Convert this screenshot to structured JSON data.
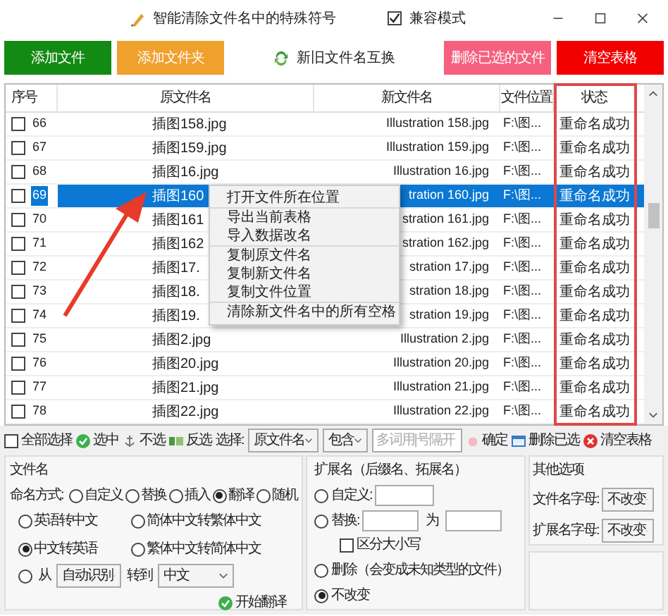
{
  "window": {
    "title": "智能清除文件名中的特殊符号",
    "compat_mode": {
      "label": "兼容模式",
      "checked": true
    }
  },
  "top_buttons": [
    {
      "label": "添加文件",
      "kind": "filled",
      "color": "#138a13"
    },
    {
      "label": "添加文件夹",
      "kind": "filled",
      "color": "#f0a02c"
    },
    {
      "label": "新旧文件名互换",
      "kind": "icon"
    },
    {
      "label": "删除已选的文件",
      "kind": "filled",
      "color": "#f5607e"
    },
    {
      "label": "清空表格",
      "kind": "filled",
      "color": "#f20000"
    }
  ],
  "table": {
    "columns": [
      "序号",
      "原文件名",
      "新文件名",
      "文件位置",
      "状态"
    ],
    "rows": [
      {
        "number": "66",
        "original": "插图158.jpg",
        "new": "Illustration 158.jpg",
        "location": "F:\\图...",
        "status": "重命名成功",
        "checked": false,
        "selected": false
      },
      {
        "number": "67",
        "original": "插图159.jpg",
        "new": "Illustration 159.jpg",
        "location": "F:\\图...",
        "status": "重命名成功",
        "checked": false,
        "selected": false
      },
      {
        "number": "68",
        "original": "插图16.jpg",
        "new": "Illustration 16.jpg",
        "location": "F:\\图...",
        "status": "重命名成功",
        "checked": false,
        "selected": false
      },
      {
        "number": "69",
        "original": "插图160",
        "new": "tration 160.jpg",
        "location": "F:\\图...",
        "status": "重命名成功",
        "checked": false,
        "selected": true
      },
      {
        "number": "70",
        "original": "插图161",
        "new": "stration 161.jpg",
        "location": "F:\\图...",
        "status": "重命名成功",
        "checked": false,
        "selected": false
      },
      {
        "number": "71",
        "original": "插图162",
        "new": "stration 162.jpg",
        "location": "F:\\图...",
        "status": "重命名成功",
        "checked": false,
        "selected": false
      },
      {
        "number": "72",
        "original": "插图17.",
        "new": "stration 17.jpg",
        "location": "F:\\图...",
        "status": "重命名成功",
        "checked": false,
        "selected": false
      },
      {
        "number": "73",
        "original": "插图18.",
        "new": "stration 18.jpg",
        "location": "F:\\图...",
        "status": "重命名成功",
        "checked": false,
        "selected": false
      },
      {
        "number": "74",
        "original": "插图19.",
        "new": "stration 19.jpg",
        "location": "F:\\图...",
        "status": "重命名成功",
        "checked": false,
        "selected": false
      },
      {
        "number": "75",
        "original": "插图2.jpg",
        "new": "Illustration 2.jpg",
        "location": "F:\\图...",
        "status": "重命名成功",
        "checked": false,
        "selected": false
      },
      {
        "number": "76",
        "original": "插图20.jpg",
        "new": "Illustration 20.jpg",
        "location": "F:\\图...",
        "status": "重命名成功",
        "checked": false,
        "selected": false
      },
      {
        "number": "77",
        "original": "插图21.jpg",
        "new": "Illustration 21.jpg",
        "location": "F:\\图...",
        "status": "重命名成功",
        "checked": false,
        "selected": false
      },
      {
        "number": "78",
        "original": "插图22.jpg",
        "new": "Illustration 22.jpg",
        "location": "F:\\图...",
        "status": "重命名成功",
        "checked": false,
        "selected": false
      }
    ]
  },
  "context_menu": {
    "groups": [
      [
        "打开文件所在位置"
      ],
      [
        "导出当前表格",
        "导入数据改名"
      ],
      [
        "复制原文件名",
        "复制新文件名",
        "复制文件位置"
      ],
      [
        "清除新文件名中的所有空格"
      ]
    ]
  },
  "selection_bar": {
    "select_all": {
      "label": "全部选择",
      "checked": false
    },
    "actions": [
      {
        "label": "选中",
        "kind": "check"
      },
      {
        "label": "不选",
        "kind": "anchor"
      },
      {
        "label": "反选",
        "kind": "invert"
      }
    ],
    "select_label": "选择:",
    "field_select": "原文件名",
    "match_select": "包含",
    "keyword_placeholder": "多词用|号隔开",
    "confirm": "确定",
    "delete_selected": "删除已选",
    "clear_table": "清空表格"
  },
  "filename_panel": {
    "title": "文件名",
    "mode_label": "命名方式:",
    "modes": [
      {
        "label": "自定义",
        "selected": false
      },
      {
        "label": "替换",
        "selected": false
      },
      {
        "label": "插入",
        "selected": false
      },
      {
        "label": "翻译",
        "selected": true
      },
      {
        "label": "随机",
        "selected": false
      }
    ],
    "translate_options": [
      {
        "label": "英语转中文",
        "selected": false
      },
      {
        "label": "简体中文转繁体中文",
        "selected": false
      },
      {
        "label": "中文转英语",
        "selected": true
      },
      {
        "label": "繁体中文转简体中文",
        "selected": false
      }
    ],
    "from_option": {
      "label": "从",
      "selected": false
    },
    "from_lang": "自动识别",
    "to_label": "转到",
    "to_lang": "中文",
    "start": "开始翻译"
  },
  "extension_panel": {
    "title": "扩展名（后缀名、拓展名）",
    "options": [
      {
        "kind": "custom",
        "label": "自定义:",
        "selected": false
      },
      {
        "kind": "replace",
        "label": "替换:",
        "with_label": "为",
        "selected": false
      },
      {
        "kind": "delete",
        "label": "删除（会变成未知类型的文件）",
        "selected": false
      },
      {
        "kind": "keep",
        "label": "不改变",
        "selected": true
      }
    ],
    "case_sensitive": {
      "label": "区分大小写",
      "checked": false
    }
  },
  "other_panel": {
    "title": "其他选项",
    "rows": [
      {
        "label": "文件名字母:",
        "value": "不改变"
      },
      {
        "label": "扩展名字母:",
        "value": "不改变"
      }
    ]
  }
}
